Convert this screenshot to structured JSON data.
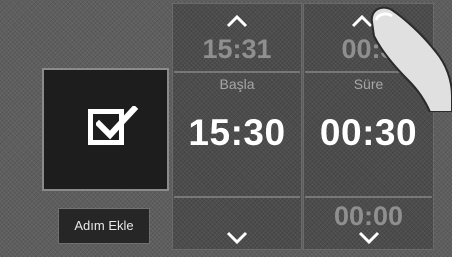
{
  "add_step_button": {
    "label": "Adım Ekle"
  },
  "start": {
    "label": "Başla",
    "next_value": "15:31",
    "current_value": "15:30"
  },
  "duration": {
    "label": "Süre",
    "next_value": "00:3",
    "current_value": "00:30",
    "previous_value": "00:00"
  },
  "icons": {
    "checkbox": "checkbox-checked-icon",
    "up": "chevron-up-icon",
    "down": "chevron-down-icon",
    "pointer": "finger-pointer"
  }
}
